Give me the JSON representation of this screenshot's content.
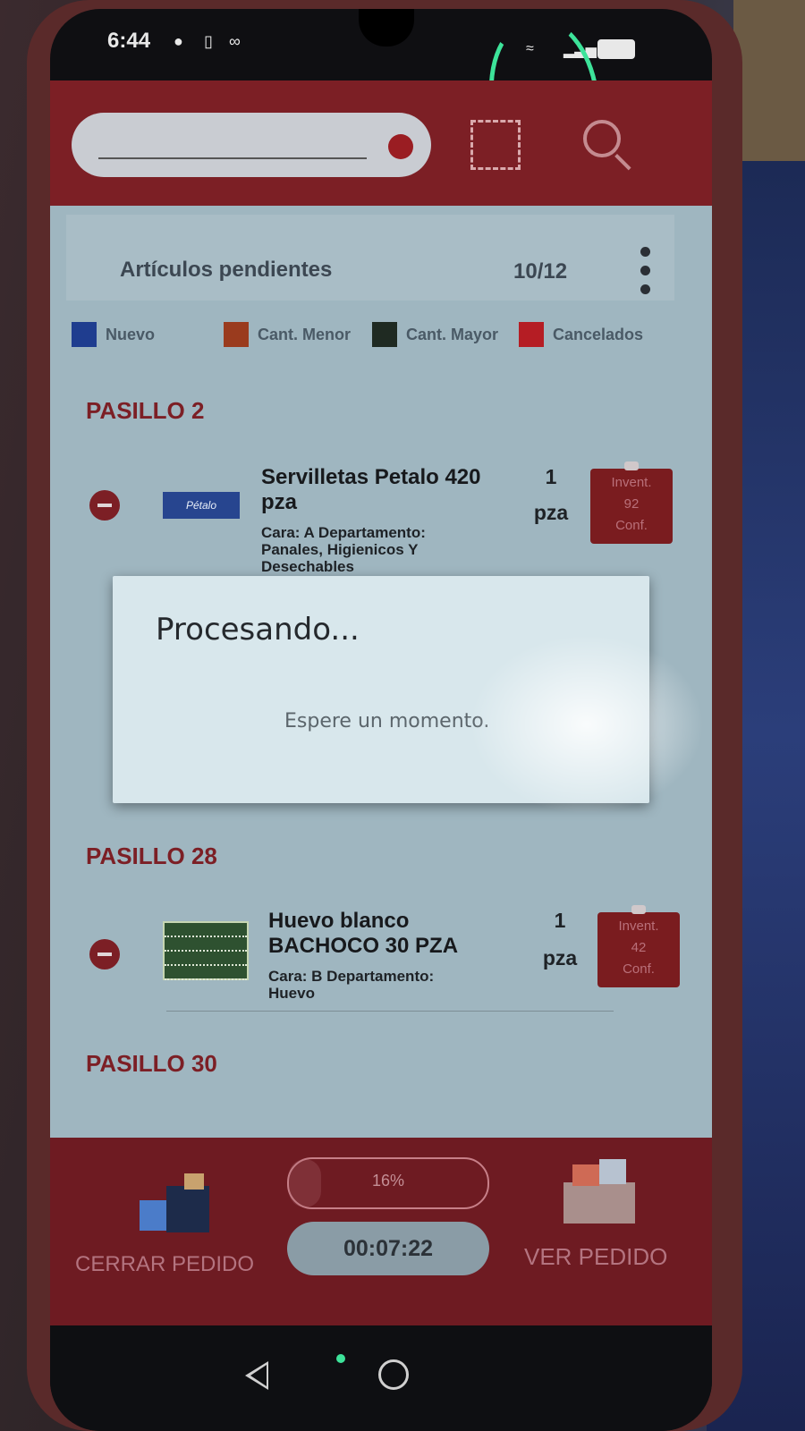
{
  "status_bar": {
    "time": "6:44",
    "icons": [
      "chat-icon",
      "phone-icon",
      "voicemail-icon",
      "wifi-icon",
      "signal-icon",
      "battery-icon"
    ]
  },
  "header": {
    "title": "Artículos pendientes",
    "count": "10/12"
  },
  "legend": [
    {
      "label": "Nuevo",
      "color": "#1f3d8f"
    },
    {
      "label": "Cant. Menor",
      "color": "#9a3b1e"
    },
    {
      "label": "Cant. Mayor",
      "color": "#1f2a22"
    },
    {
      "label": "Cancelados",
      "color": "#b51d24"
    }
  ],
  "sections": [
    {
      "aisle": "PASILLO 2",
      "item": {
        "name": "Servilletas  Petalo 420 pza",
        "thumb_label": "Pétalo",
        "desc": "Cara: A Departamento: Panales, Higienicos Y Desechables",
        "qty_num": "1",
        "qty_unit": "pza",
        "inv_label": "Invent.",
        "inv_value": "92",
        "inv_sub": "Conf."
      }
    },
    {
      "aisle": "PASILLO 28",
      "item": {
        "name": "Huevo blanco BACHOCO 30 PZA",
        "desc": "Cara: B Departamento: Huevo",
        "qty_num": "1",
        "qty_unit": "pza",
        "inv_label": "Invent.",
        "inv_value": "42",
        "inv_sub": "Conf."
      }
    },
    {
      "aisle": "PASILLO 30"
    }
  ],
  "dialog": {
    "title": "Procesando...",
    "message": "Espere un momento."
  },
  "bottom_bar": {
    "close_label": "CERRAR PEDIDO",
    "progress_text": "16%",
    "progress": 0.16,
    "timer": "00:07:22",
    "see_label": "VER PEDIDO"
  },
  "colors": {
    "brand": "#7c1f25",
    "highlight": "#3de39a"
  }
}
